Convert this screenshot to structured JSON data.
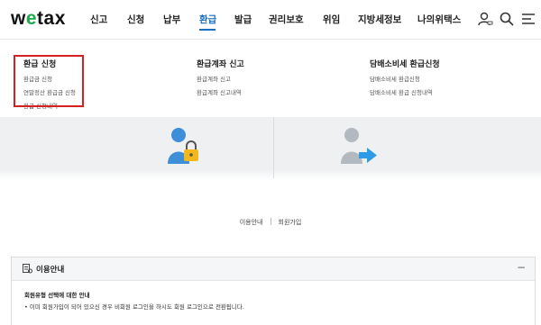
{
  "header": {
    "logo_prefix": "w",
    "logo_o": "e",
    "logo_suffix": "tax",
    "nav": [
      "신고",
      "신청",
      "납부",
      "환급",
      "발급",
      "권리보호",
      "위임",
      "지방세정보",
      "나의위택스"
    ],
    "active_nav": "환급"
  },
  "dropdown": {
    "columns": [
      {
        "title": "환급 신청",
        "links": [
          "환급금 신청",
          "연말정산 환급금 신청",
          "환급 신청내역"
        ]
      },
      {
        "title": "환급계좌 신고",
        "links": [
          "환급계좌 신고",
          "환급계좌 신고내역"
        ]
      },
      {
        "title": "담배소비세 환급신청",
        "links": [
          "담배소비세 환급신청",
          "담배소비세 환급 신청내역"
        ]
      }
    ]
  },
  "links": {
    "usage": "이용안내",
    "join": "회원가입"
  },
  "info": {
    "title": "이용안내",
    "collapse": "−",
    "subtitle": "회원유형 선택에 대한 안내",
    "text": "• 이미 회원가입이 되어 있으신 경우 비회원 로그인을 하시도 회원 로그인으로 전환됩니다."
  },
  "colors": {
    "active": "#1a6fc4",
    "highlight": "#d62020",
    "logo_accent": "#1fa84a"
  }
}
